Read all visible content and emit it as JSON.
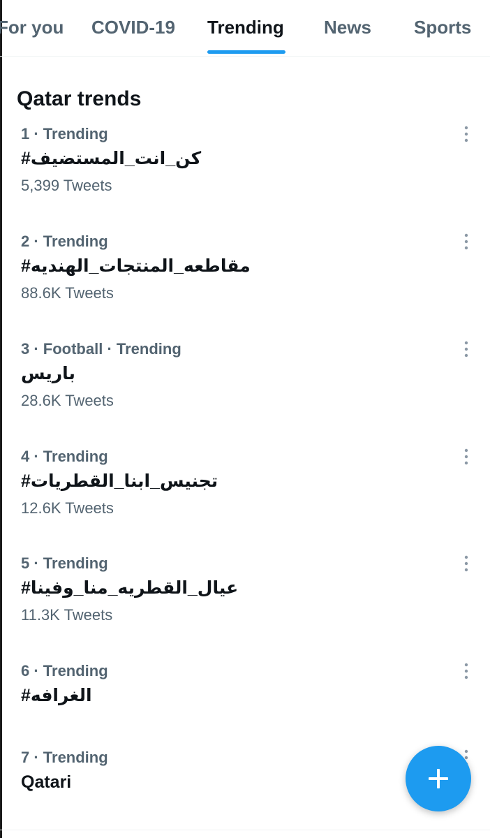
{
  "tabs": [
    {
      "label": "For you"
    },
    {
      "label": "COVID-19"
    },
    {
      "label": "Trending"
    },
    {
      "label": "News"
    },
    {
      "label": "Sports"
    }
  ],
  "active_tab": "Trending",
  "section_title": "Qatar trends",
  "trends": [
    {
      "meta": "1 · Trending",
      "name": "#كن_انت_المستضيف",
      "count": "5,399 Tweets"
    },
    {
      "meta": "2 · Trending",
      "name": "#مقاطعه_المنتجات_الهنديه",
      "count": "88.6K Tweets"
    },
    {
      "meta": "3 · Football · Trending",
      "name": "باريس",
      "count": "28.6K Tweets"
    },
    {
      "meta": "4 · Trending",
      "name": "#تجنيس_ابنا_القطريات",
      "count": "12.6K Tweets"
    },
    {
      "meta": "5 · Trending",
      "name": "#عيال_القطريه_منا_وفينا",
      "count": "11.3K Tweets"
    },
    {
      "meta": "6 · Trending",
      "name": "#الغرافه",
      "count": ""
    },
    {
      "meta": "7 · Trending",
      "name": "Qatari",
      "count": ""
    }
  ],
  "icons": {
    "more": "more-vertical-icon",
    "compose": "plus-icon"
  },
  "colors": {
    "accent": "#1d9bf0",
    "text_primary": "#0f1419",
    "text_secondary": "#536471",
    "divider": "#eff3f4"
  }
}
